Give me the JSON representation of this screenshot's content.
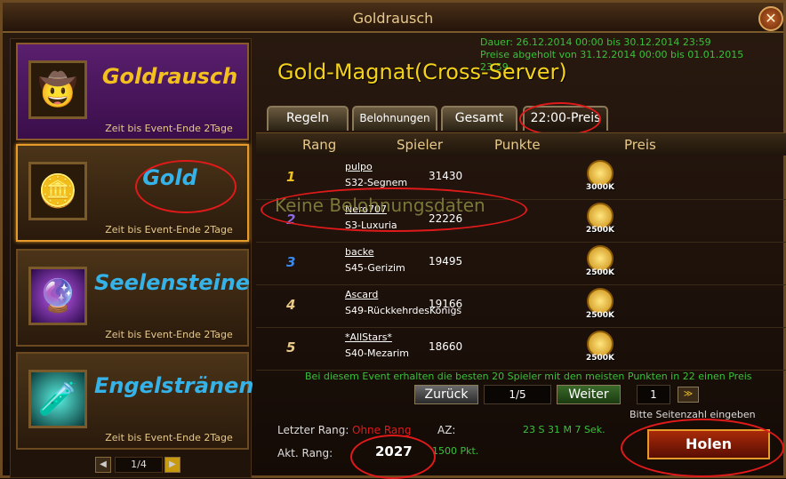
{
  "window": {
    "title": "Goldrausch",
    "close_symbol": "✕"
  },
  "left": {
    "cards": [
      {
        "name": "Goldrausch",
        "sub": "Zeit bis Event-Ende 2Tage",
        "icon": "cowboy-portrait",
        "name_color": "#f3c020"
      },
      {
        "name": "Gold",
        "sub": "Zeit bis Event-Ende 2Tage",
        "icon": "gold-coin",
        "name_color": "#35b2e8"
      },
      {
        "name": "Seelensteine",
        "sub": "Zeit bis Event-Ende 2Tage",
        "icon": "soulstone-orb",
        "name_color": "#35b2e8"
      },
      {
        "name": "Engelstränen",
        "sub": "Zeit bis Event-Ende 2Tage",
        "icon": "angel-tear-vial",
        "name_color": "#35b2e8"
      }
    ],
    "pager": {
      "page": "1/4",
      "prev": "◀",
      "next": "▶"
    }
  },
  "main": {
    "dates": {
      "line1": "Dauer: 26.12.2014 00:00 bis 30.12.2014 23:59",
      "line2": "Preise abgeholt von 31.12.2014 00:00 bis 01.01.2015 23:59"
    },
    "title": "Gold-Magnat(Cross-Server)",
    "tabs": [
      "Regeln",
      "Belohnungen",
      "Gesamt",
      "22:00-Preis"
    ],
    "headers": {
      "rank": "Rang",
      "player": "Spieler",
      "points": "Punkte",
      "prize": "Preis"
    },
    "rows": [
      {
        "rank": "1",
        "rank_color": "#f0c020",
        "name": "pulpo",
        "server": "S32-Segnem",
        "points": "31430",
        "prize": "3000K"
      },
      {
        "rank": "2",
        "rank_color": "#8a6ae0",
        "name": "Nero707",
        "server": "S3-Luxuria",
        "points": "22226",
        "prize": "2500K"
      },
      {
        "rank": "3",
        "rank_color": "#3a8af0",
        "name": "backe",
        "server": "S45-Gerizim",
        "points": "19495",
        "prize": "2500K"
      },
      {
        "rank": "4",
        "rank_color": "#e7c98a",
        "name": "Ascard",
        "server": "S49-RückkehrdesKönigs",
        "points": "19166",
        "prize": "2500K"
      },
      {
        "rank": "5",
        "rank_color": "#e7c98a",
        "name": "*AllStars*",
        "server": "S40-Mezarim",
        "points": "18660",
        "prize": "2500K"
      }
    ],
    "overlay_text": "Keine Belohnungsdaten",
    "notice": "Bei diesem Event erhalten die besten 20 Spieler mit den meisten Punkten in 22 einen Preis",
    "pager": {
      "back": "Zurück",
      "page": "1/5",
      "next": "Weiter",
      "input_value": "1",
      "go": "≫",
      "hint": "Bitte Seitenzahl eingeben"
    },
    "bottom": {
      "last_rank_label": "Letzter Rang:",
      "last_rank_value": "Ohne Rang",
      "current_rank_label": "Akt. Rang:",
      "current_rank_value": "2027",
      "az_label": "AZ:",
      "timer": "23 S 31 M 7 Sek.",
      "points": "1500 Pkt."
    },
    "claim_button": "Holen"
  }
}
